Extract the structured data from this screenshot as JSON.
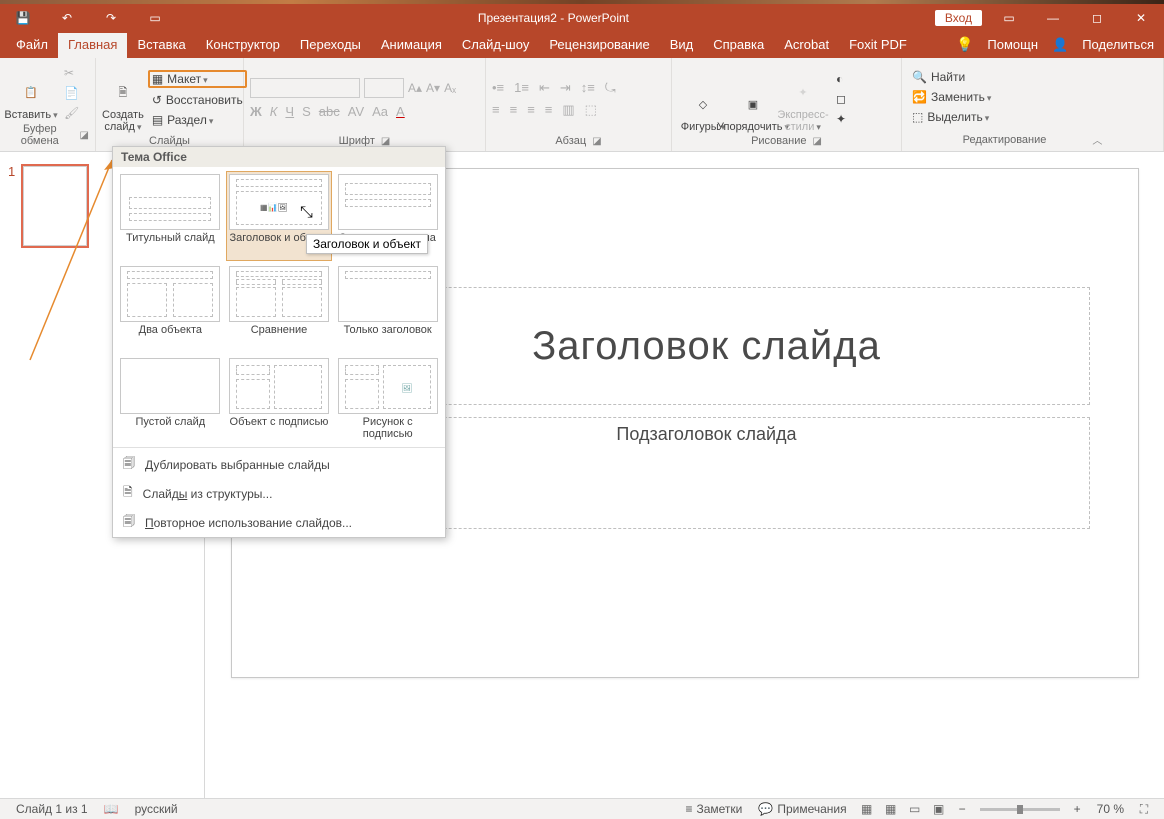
{
  "titlebar": {
    "title": "Презентация2  -  PowerPoint",
    "login": "Вход"
  },
  "tabs": {
    "file": "Файл",
    "home": "Главная",
    "insert": "Вставка",
    "design": "Конструктор",
    "transitions": "Переходы",
    "animations": "Анимация",
    "slideshow": "Слайд-шоу",
    "review": "Рецензирование",
    "view": "Вид",
    "help": "Справка",
    "acrobat": "Acrobat",
    "foxit": "Foxit PDF",
    "tell": "Помощн",
    "share": "Поделиться"
  },
  "ribbon": {
    "clipboard": {
      "paste": "Вставить",
      "label": "Буфер обмена"
    },
    "slides": {
      "newslide": "Создать слайд",
      "layout": "Макет",
      "reset": "Восстановить",
      "section": "Раздел",
      "label": "Слайды"
    },
    "font": {
      "label": "Шрифт"
    },
    "paragraph": {
      "label": "Абзац"
    },
    "drawing": {
      "shapes": "Фигуры",
      "arrange": "Упорядочить",
      "quick": "Экспресс-стили",
      "label": "Рисование"
    },
    "editing": {
      "find": "Найти",
      "replace": "Заменить",
      "select": "Выделить",
      "label": "Редактирование"
    }
  },
  "popup": {
    "header": "Тема Office",
    "layouts": {
      "title": "Титульный слайд",
      "titlecontent": "Заголовок и объект",
      "section": "Заголовок раздела",
      "two": "Два объекта",
      "comparison": "Сравнение",
      "titleonly": "Только заголовок",
      "blank": "Пустой слайд",
      "objcap": "Объект с подписью",
      "piccap": "Рисунок с подписью"
    },
    "menu": {
      "duplicate": "Дублировать выбранные слайды",
      "outline": "Слайды из структуры...",
      "reuse": "Повторное использование слайдов..."
    },
    "tooltip": "Заголовок и объект"
  },
  "slide": {
    "title": "Заголовок слайда",
    "subtitle": "Подзаголовок слайда"
  },
  "thumbs": {
    "num1": "1"
  },
  "statusbar": {
    "slideinfo": "Слайд 1 из 1",
    "lang": "русский",
    "notes": "Заметки",
    "comments": "Примечания",
    "zoom": "70 %"
  }
}
